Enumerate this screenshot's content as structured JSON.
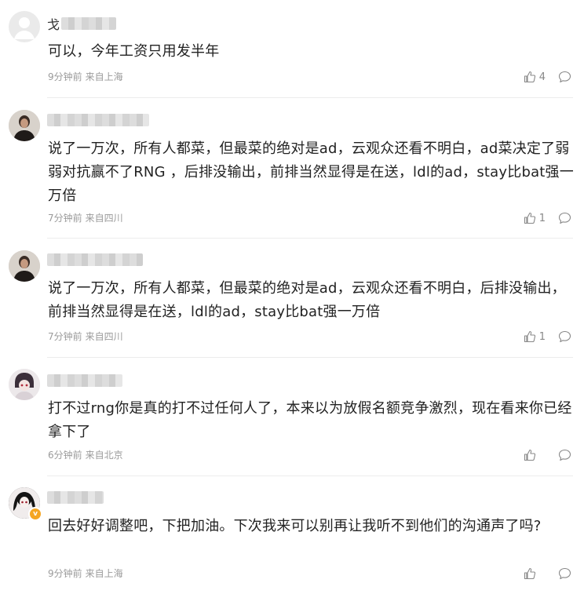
{
  "comments": [
    {
      "name_visible": "戈",
      "text": "可以，今年工资只用发半年",
      "time": "9分钟前",
      "location": "来自上海",
      "likes": "4"
    },
    {
      "name_visible": "",
      "text": "说了一万次，所有人都菜，但最菜的绝对是ad，云观众还看不明白，ad菜决定了弱弱对抗赢不了RNG ，后排没输出，前排当然显得是在送，ldl的ad，stay比bat强一万倍",
      "time": "7分钟前",
      "location": "来自四川",
      "likes": "1"
    },
    {
      "name_visible": "",
      "text": "说了一万次，所有人都菜，但最菜的绝对是ad，云观众还看不明白，后排没输出，前排当然显得是在送，ldl的ad，stay比bat强一万倍",
      "time": "7分钟前",
      "location": "来自四川",
      "likes": "1"
    },
    {
      "name_visible": "",
      "text": "打不过rng你是真的打不过任何人了，本来以为放假名额竞争激烈，现在看来你已经拿下了",
      "time": "6分钟前",
      "location": "来自北京",
      "likes": ""
    },
    {
      "name_visible": "",
      "text": "回去好好调整吧，下把加油。下次我来可以别再让我听不到他们的沟通声了吗?",
      "time": "9分钟前",
      "location": "来自上海",
      "likes": ""
    }
  ],
  "colors": {
    "text": "#222222",
    "meta": "#9a9a9a",
    "badge": "#f5a623"
  },
  "icons": [
    "thumbs-up-icon",
    "comment-icon",
    "verified-badge-icon"
  ]
}
